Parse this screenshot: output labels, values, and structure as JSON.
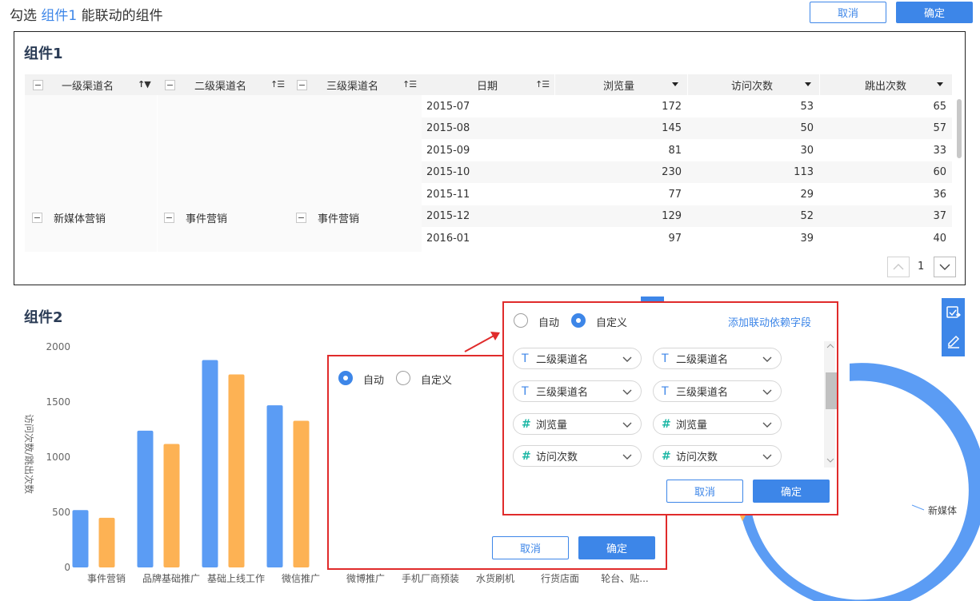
{
  "header": {
    "title_prefix": "勾选",
    "title_link": "组件1",
    "title_suffix": "能联动的组件",
    "cancel_label": "取消",
    "confirm_label": "确定"
  },
  "widget1": {
    "title": "组件1",
    "columns": [
      "一级渠道名",
      "二级渠道名",
      "三级渠道名",
      "日期",
      "浏览量",
      "访问次数",
      "跳出次数"
    ],
    "dims": {
      "level1": "新媒体营销",
      "level2": "事件营销",
      "level3": "事件营销"
    },
    "rows": [
      {
        "date": "2015-07",
        "views": "172",
        "visits": "53",
        "bounces": "65"
      },
      {
        "date": "2015-08",
        "views": "145",
        "visits": "50",
        "bounces": "57"
      },
      {
        "date": "2015-09",
        "views": "81",
        "visits": "30",
        "bounces": "33"
      },
      {
        "date": "2015-10",
        "views": "230",
        "visits": "113",
        "bounces": "60"
      },
      {
        "date": "2015-11",
        "views": "77",
        "visits": "29",
        "bounces": "36"
      },
      {
        "date": "2015-12",
        "views": "129",
        "visits": "52",
        "bounces": "37"
      },
      {
        "date": "2016-01",
        "views": "97",
        "visits": "39",
        "bounces": "40"
      }
    ],
    "page": "1"
  },
  "widget2": {
    "title": "组件2",
    "donut_label": "新媒体"
  },
  "chart_data": {
    "type": "bar",
    "ylabel": "访问次数/跳出次数",
    "ylim": [
      0,
      2000
    ],
    "yticks": [
      "0",
      "500",
      "1000",
      "1500",
      "2000"
    ],
    "categories": [
      "事件营销",
      "品牌基础推广",
      "基础上线工作",
      "微信推广",
      "微博推广",
      "手机厂商预装",
      "水货刷机",
      "行货店面",
      "轮台、贴..."
    ],
    "series": [
      {
        "values": [
          520,
          1240,
          1880,
          1470,
          null,
          null,
          null,
          null,
          null
        ],
        "color": "#5b9cf4"
      },
      {
        "values": [
          450,
          1120,
          1750,
          1330,
          null,
          null,
          null,
          null,
          null
        ],
        "color": "#fdb254"
      }
    ]
  },
  "popup_auto": {
    "auto_label": "自动",
    "custom_label": "自定义",
    "selected": "auto",
    "cancel_label": "取消",
    "confirm_label": "确定"
  },
  "popup_custom": {
    "auto_label": "自动",
    "custom_label": "自定义",
    "selected": "custom",
    "add_link": "添加联动依赖字段",
    "pairs": [
      {
        "type": "T",
        "left": "二级渠道名",
        "right": "二级渠道名"
      },
      {
        "type": "T",
        "left": "三级渠道名",
        "right": "三级渠道名"
      },
      {
        "type": "#",
        "left": "浏览量",
        "right": "浏览量"
      },
      {
        "type": "#",
        "left": "访问次数",
        "right": "访问次数"
      }
    ],
    "cancel_label": "取消",
    "confirm_label": "确定"
  },
  "colors": {
    "accent": "#3d86e8",
    "highlight_border": "#e02b2b",
    "bar_blue": "#5b9cf4",
    "bar_orange": "#fdb254"
  }
}
